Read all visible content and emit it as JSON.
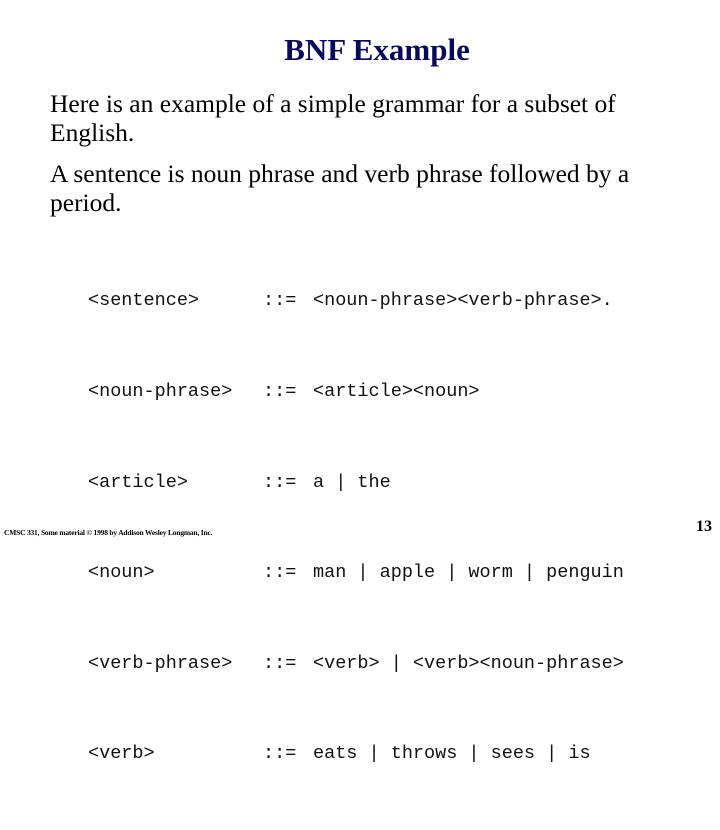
{
  "slide": {
    "title": "BNF Example",
    "paragraphs": [
      "Here is an example of a simple grammar for a subset of English.",
      "A sentence is noun phrase and verb phrase followed by a period."
    ],
    "grammar": {
      "operator": "::=",
      "rules": [
        {
          "lhs": "<sentence>",
          "rhs": "<noun-phrase><verb-phrase>."
        },
        {
          "lhs": "<noun-phrase>",
          "rhs": "<article><noun>"
        },
        {
          "lhs": "<article>",
          "rhs": "a | the"
        },
        {
          "lhs": "<noun>",
          "rhs": "man | apple | worm | penguin"
        },
        {
          "lhs": "<verb-phrase>",
          "rhs": "<verb> | <verb><noun-phrase>"
        },
        {
          "lhs": "<verb>",
          "rhs": "eats | throws | sees | is"
        }
      ]
    },
    "footer": "CMSC 331, Some material © 1998 by Addison Wesley Longman, Inc.",
    "page_number": "13"
  }
}
